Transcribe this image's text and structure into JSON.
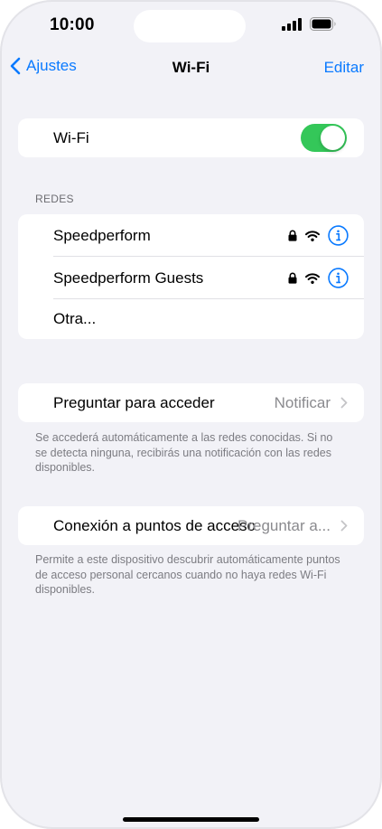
{
  "status": {
    "time": "10:00"
  },
  "nav": {
    "back_label": "Ajustes",
    "title": "Wi-Fi",
    "edit_label": "Editar"
  },
  "wifi": {
    "label": "Wi-Fi",
    "enabled": true
  },
  "networks": {
    "header": "REDES",
    "items": [
      {
        "name": "Speedperform",
        "locked": true
      },
      {
        "name": "Speedperform Guests",
        "locked": true
      }
    ],
    "other_label": "Otra..."
  },
  "ask_join": {
    "label": "Preguntar para acceder",
    "value": "Notificar",
    "footer": "Se accederá automáticamente a las redes conocidas. Si no se detecta ninguna, recibirás una notificación con las redes disponibles."
  },
  "hotspot": {
    "label": "Conexión a puntos de acceso",
    "value": "Preguntar a...",
    "footer": "Permite a este dispositivo descubrir automáticamente puntos de acceso personal cercanos cuando no haya redes Wi-Fi disponibles."
  },
  "colors": {
    "accent": "#0a7aff",
    "toggle_on": "#34c759",
    "background": "#f2f2f7"
  }
}
